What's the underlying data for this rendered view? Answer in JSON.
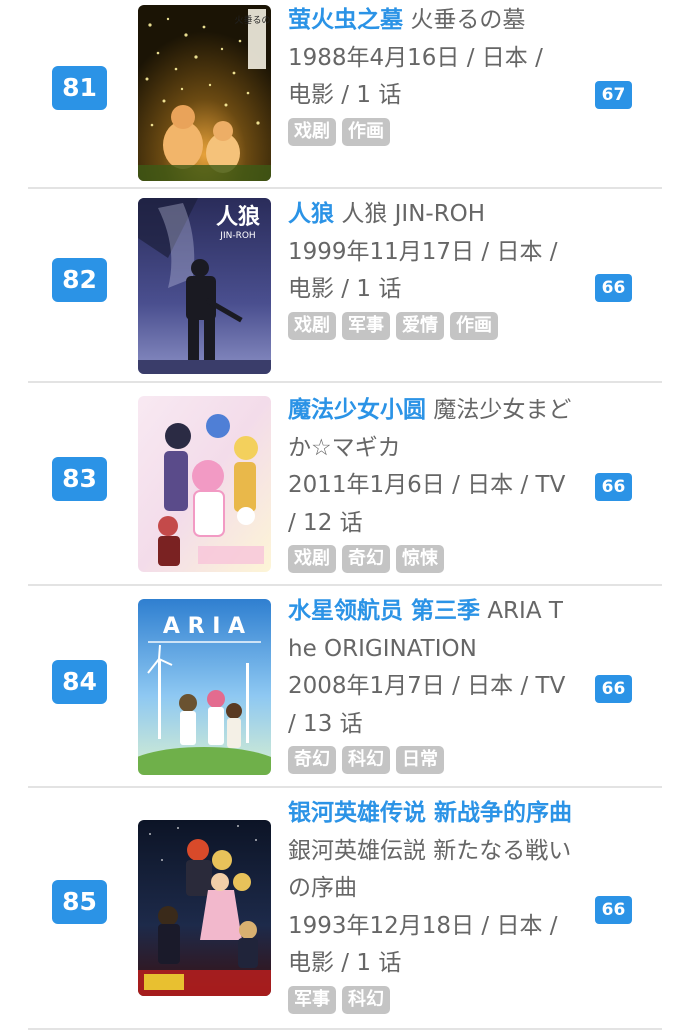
{
  "items": [
    {
      "rank": "81",
      "title_cn": "萤火虫之墓",
      "title_orig": "火垂るの墓",
      "meta": "1988年4月16日 / 日本 / 电影 / 1 话",
      "tags": [
        "戏剧",
        "作画"
      ],
      "score": "67",
      "poster_text": "火垂るの墓",
      "poster_icon": "night-fireflies-poster"
    },
    {
      "rank": "82",
      "title_cn": "人狼",
      "title_orig": "人狼 JIN-ROH",
      "meta": "1999年11月17日 / 日本 / 电影 / 1 话",
      "tags": [
        "戏剧",
        "军事",
        "爱情",
        "作画"
      ],
      "score": "66",
      "poster_text": "人狼",
      "poster_subtext": "JIN-ROH",
      "poster_icon": "armored-soldier-poster"
    },
    {
      "rank": "83",
      "title_cn": "魔法少女小圆",
      "title_orig": "魔法少女まどか☆マギカ",
      "meta": "2011年1月6日 / 日本 / TV / 12 话",
      "tags": [
        "戏剧",
        "奇幻",
        "惊悚"
      ],
      "score": "66",
      "poster_icon": "magical-girls-poster"
    },
    {
      "rank": "84",
      "title_cn": "水星领航员 第三季",
      "title_orig": "ARIA The ORIGINATION",
      "meta": "2008年1月7日 / 日本 / TV / 13 话",
      "tags": [
        "奇幻",
        "科幻",
        "日常"
      ],
      "score": "66",
      "poster_text": "A R I A",
      "poster_icon": "aria-sky-poster"
    },
    {
      "rank": "85",
      "title_cn": "银河英雄传说 新战争的序曲",
      "title_orig": "銀河英雄伝説 新たなる戦いの序曲",
      "meta": "1993年12月18日 / 日本 / 电影 / 1 话",
      "tags": [
        "军事",
        "科幻"
      ],
      "score": "66",
      "poster_icon": "galactic-heroes-poster"
    }
  ],
  "colors": {
    "accent": "#2b93e6",
    "tag_bg": "#c4c4c4",
    "divider": "#e3e3e3",
    "text": "#666666"
  }
}
